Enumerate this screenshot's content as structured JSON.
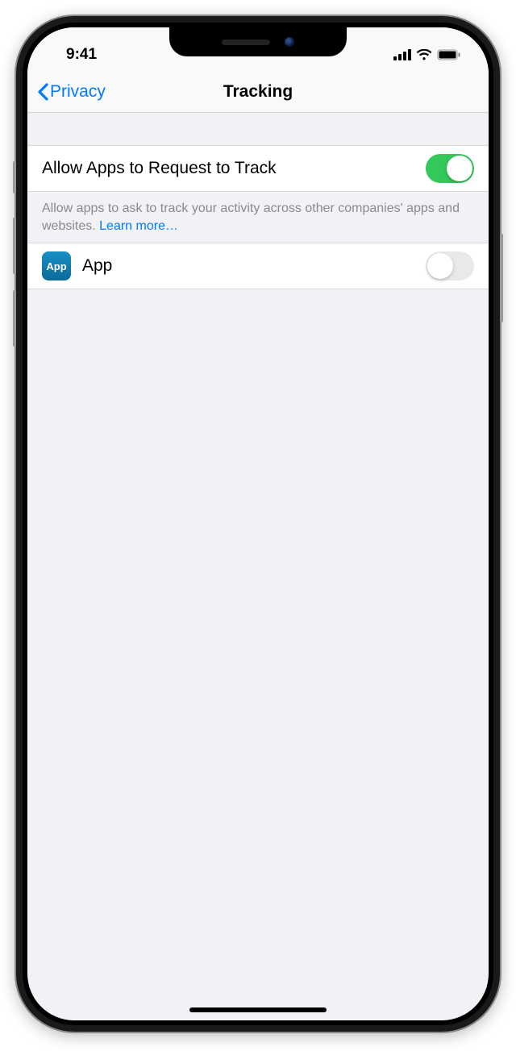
{
  "statusBar": {
    "time": "9:41"
  },
  "nav": {
    "backLabel": "Privacy",
    "title": "Tracking"
  },
  "settings": {
    "allowTracking": {
      "label": "Allow Apps to Request to Track",
      "enabled": true,
      "footer": "Allow apps to ask to track your activity across other companies' apps and websites. ",
      "learnMore": "Learn more…"
    },
    "apps": [
      {
        "name": "App",
        "iconText": "App",
        "enabled": false
      }
    ]
  }
}
